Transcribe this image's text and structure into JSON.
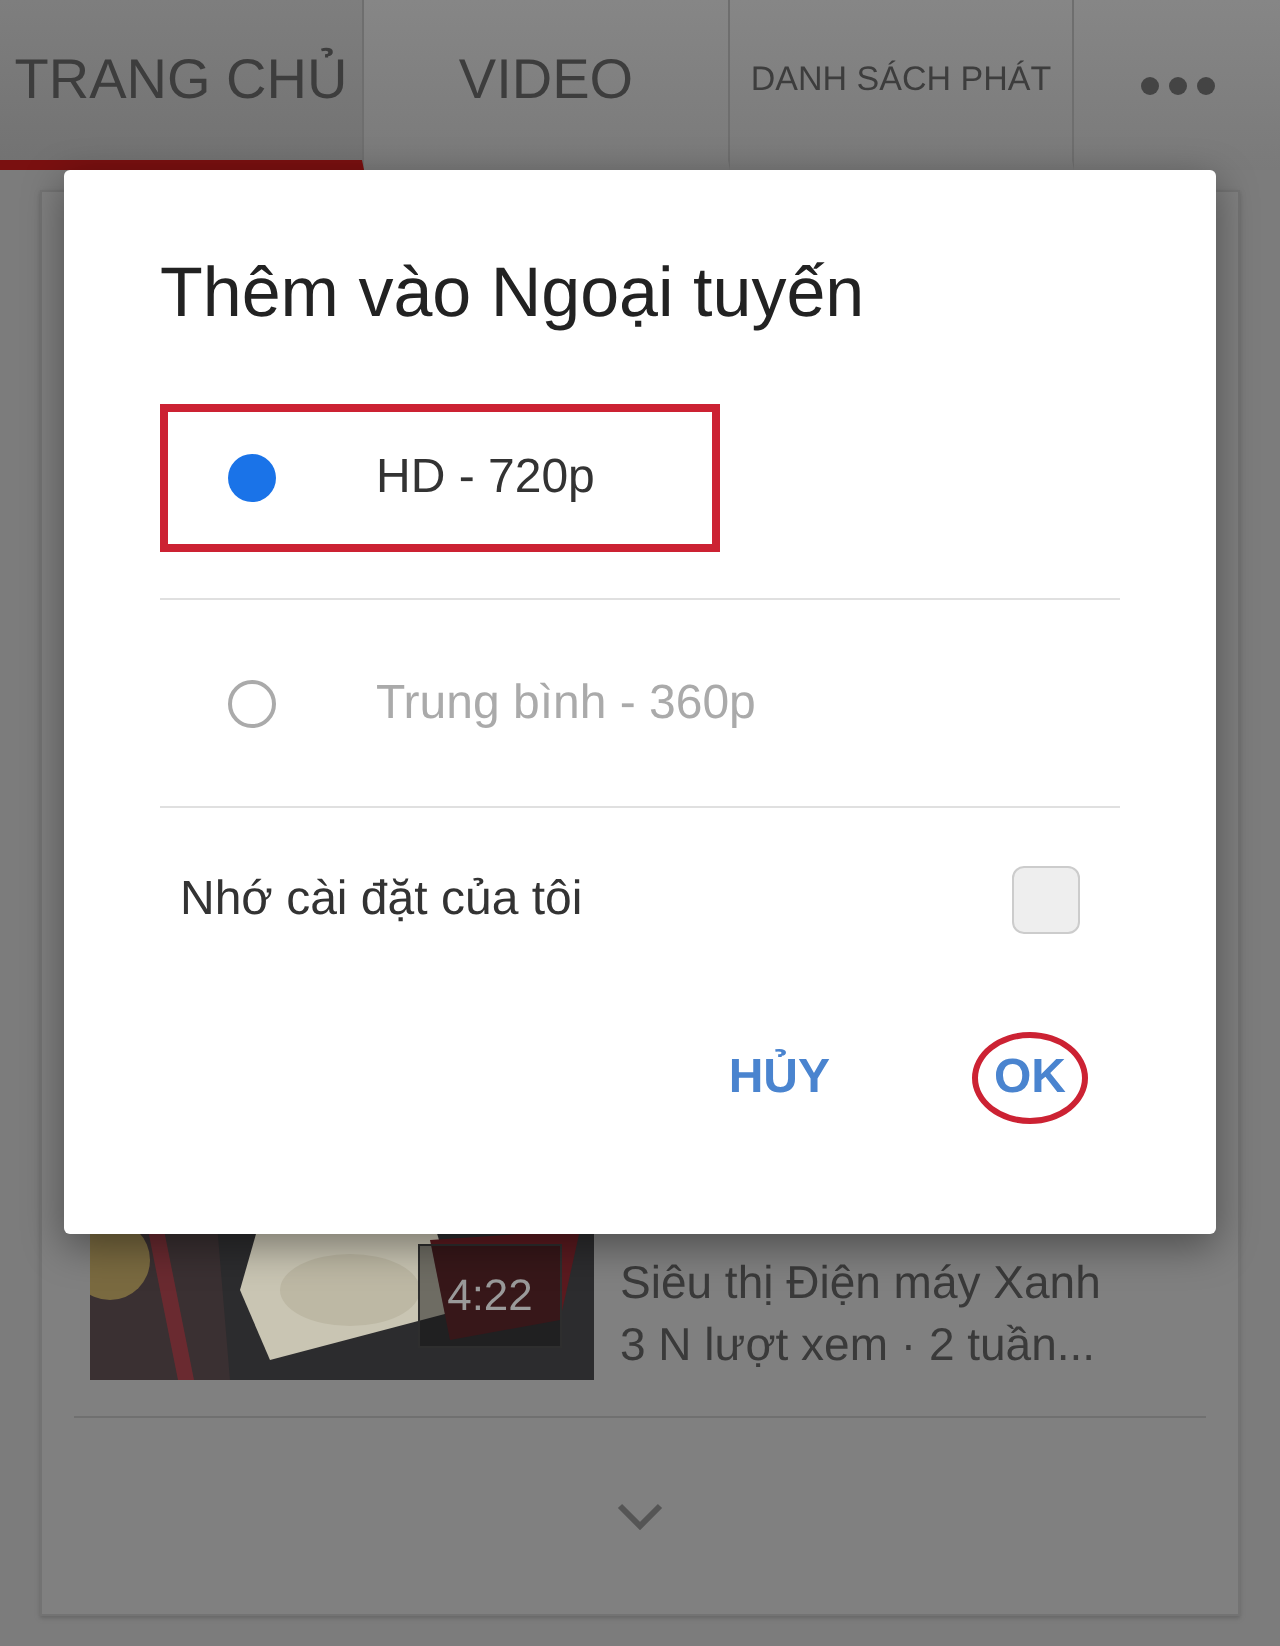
{
  "tabs": [
    {
      "label": "TRANG CHỦ",
      "selected": true
    },
    {
      "label": "VIDEO",
      "selected": false
    },
    {
      "label": "DANH SÁCH PHÁT",
      "selected": false
    }
  ],
  "video": {
    "duration": "4:22",
    "channel": "Siêu thị Điện máy Xanh",
    "meta": "3 N lượt xem · 2 tuần..."
  },
  "dialog": {
    "title": "Thêm vào Ngoại tuyến",
    "options": [
      {
        "label": "HD - 720p",
        "selected": true,
        "annotated": true
      },
      {
        "label": "Trung bình - 360p",
        "selected": false,
        "annotated": false
      }
    ],
    "remember": {
      "label": "Nhớ cài đặt của tôi",
      "checked": false
    },
    "buttons": [
      {
        "label": "HỦY",
        "annotated": false
      },
      {
        "label": "OK",
        "annotated": true
      }
    ]
  }
}
